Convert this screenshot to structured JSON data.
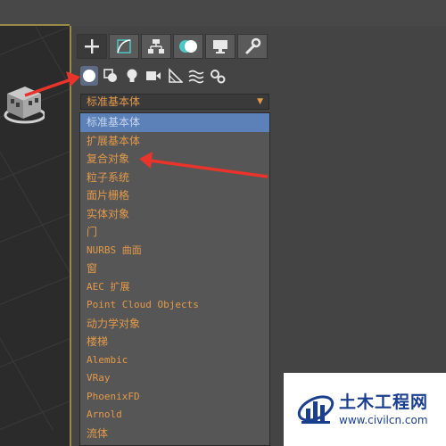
{
  "command_panel": {
    "tabs": [
      {
        "name": "create",
        "icon": "plus-icon"
      },
      {
        "name": "modify",
        "icon": "modify-curve-icon"
      },
      {
        "name": "hierarchy",
        "icon": "hierarchy-icon"
      },
      {
        "name": "motion",
        "icon": "motion-icon"
      },
      {
        "name": "display",
        "icon": "monitor-icon"
      },
      {
        "name": "utilities",
        "icon": "wrench-icon"
      }
    ],
    "sub_icons": [
      {
        "name": "geometry",
        "icon": "sphere-icon"
      },
      {
        "name": "shapes",
        "icon": "shapes-icon"
      },
      {
        "name": "lights",
        "icon": "light-bulb-icon"
      },
      {
        "name": "cameras",
        "icon": "camera-icon"
      },
      {
        "name": "helpers",
        "icon": "helper-triangle-icon"
      },
      {
        "name": "space_warps",
        "icon": "space-warp-icon"
      },
      {
        "name": "systems",
        "icon": "gears-icon"
      }
    ],
    "dropdown": {
      "selected": "标准基本体"
    },
    "list_items": [
      "标准基本体",
      "扩展基本体",
      "复合对象",
      "粒子系统",
      "面片栅格",
      "实体对象",
      "门",
      "NURBS 曲面",
      "窗",
      "AEC 扩展",
      "Point Cloud Objects",
      "动力学对象",
      "楼梯",
      "Alembic",
      "VRay",
      "PhoenixFD",
      "Arnold",
      "流体"
    ],
    "selected_index": 0
  },
  "watermark": {
    "title": "土木工程网",
    "url": "www.civilcn.com"
  },
  "colors": {
    "list_text": "#e29a4a",
    "selection": "#5b81b8",
    "panel_bg": "#444444",
    "arrow": "#e8342a"
  }
}
